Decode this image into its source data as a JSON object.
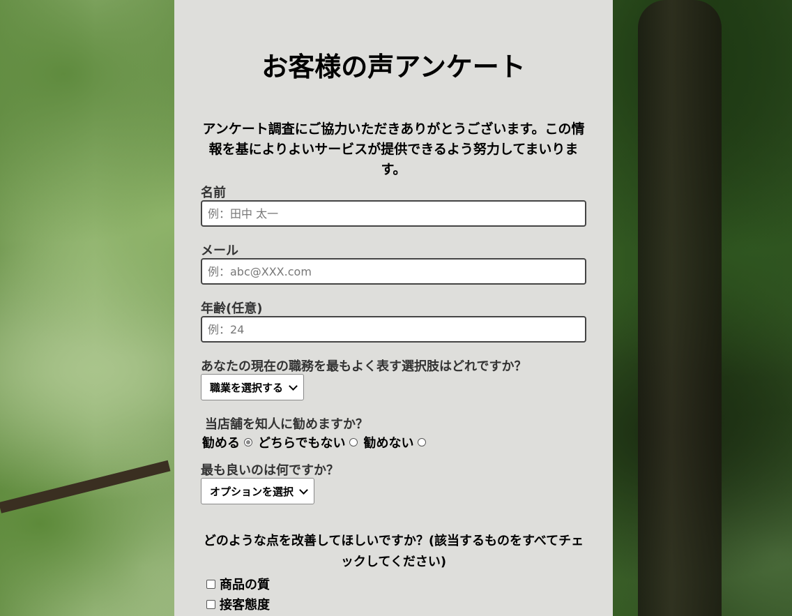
{
  "title": "お客様の声アンケート",
  "intro": "アンケート調査にご協力いただきありがとうございます。この情報を基によりよいサービスが提供できるよう努力してまいります。",
  "fields": {
    "name": {
      "label": "名前",
      "placeholder": "例：田中 太一"
    },
    "email": {
      "label": "メール",
      "placeholder": "例：abc@XXX.com"
    },
    "age": {
      "label": "年齢(任意)",
      "placeholder": "例：24"
    }
  },
  "job": {
    "question": "あなたの現在の職務を最もよく表す選択肢はどれですか？",
    "selected": "職業を選択する"
  },
  "recommend": {
    "question": "当店舗を知人に勧めますか？",
    "options": [
      "勧める",
      "どちらでもない",
      "勧めない"
    ],
    "selected_index": 0
  },
  "best": {
    "question": "最も良いのは何ですか？",
    "selected": "オプションを選択"
  },
  "improve": {
    "question": "どのような点を改善してほしいですか？(該当するものをすべてチェックしてください)",
    "options": [
      "商品の質",
      "接客態度"
    ]
  }
}
